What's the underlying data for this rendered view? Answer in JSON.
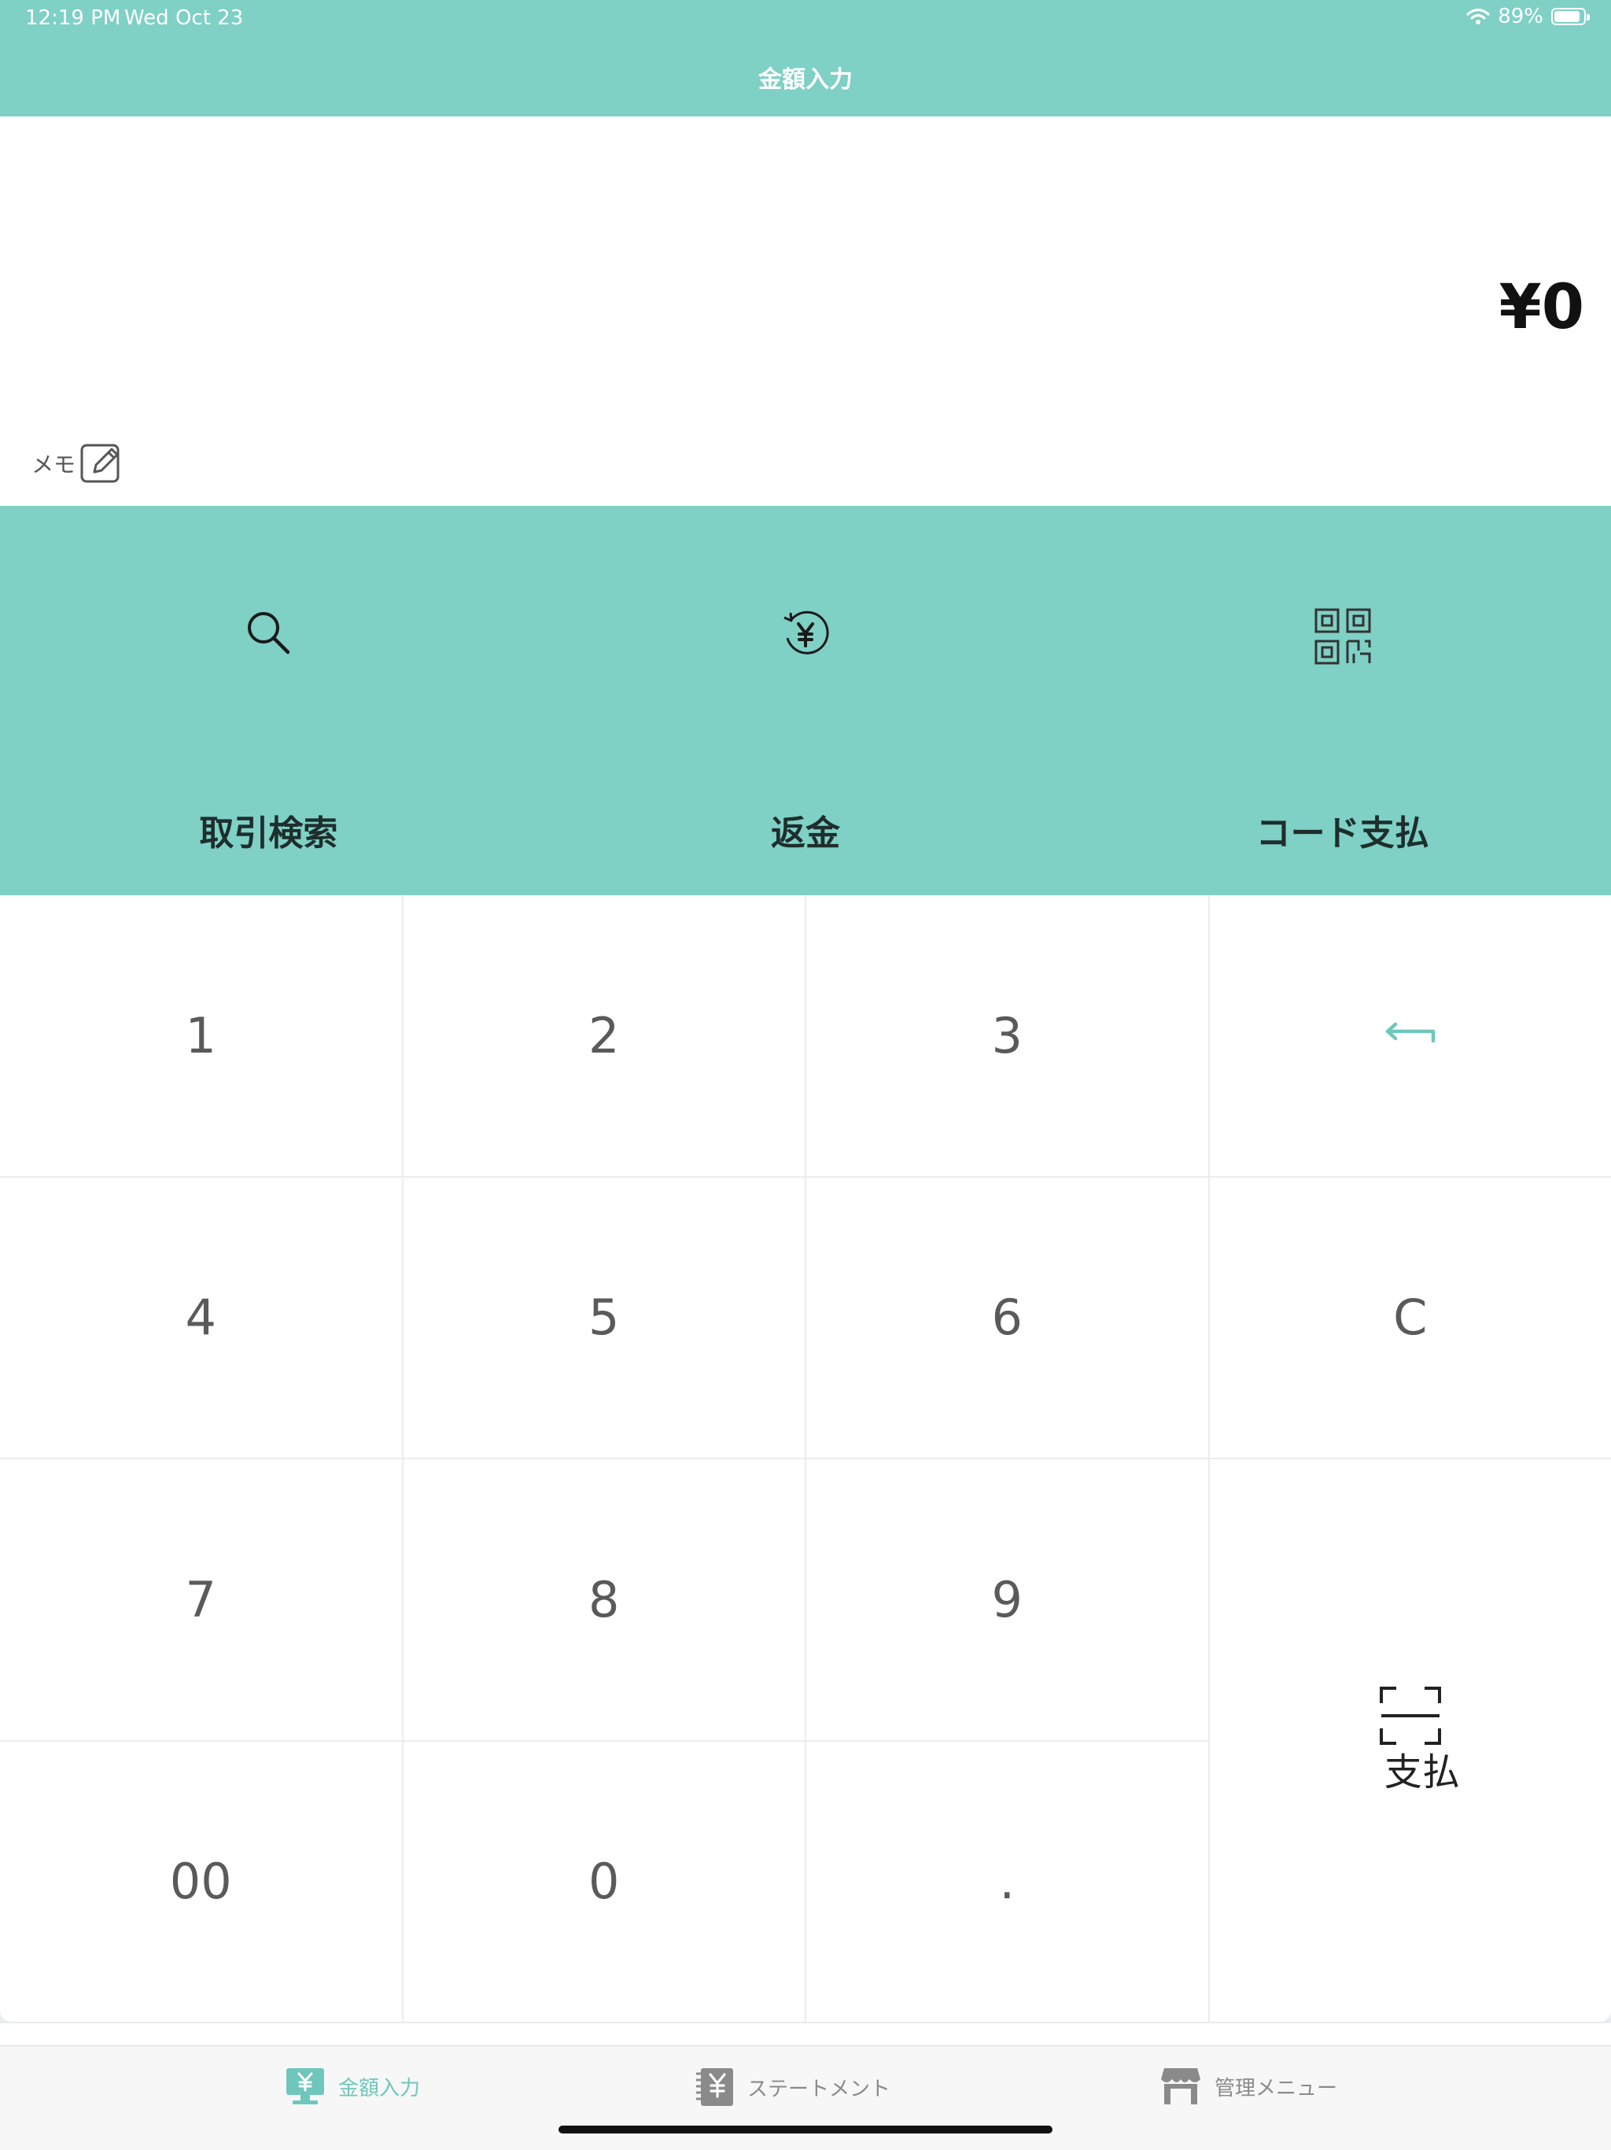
{
  "status": {
    "time": "12:19 PM",
    "date": "Wed Oct 23",
    "battery": "89%",
    "battery_level": 0.89
  },
  "nav": {
    "title": "金額入力"
  },
  "amount": {
    "display": "¥0"
  },
  "memo": {
    "label": "メモ",
    "icon": "edit-icon"
  },
  "actions": [
    {
      "label": "取引検索",
      "icon": "search-icon"
    },
    {
      "label": "返金",
      "icon": "refund-yen-icon"
    },
    {
      "label": "コード支払",
      "icon": "qr-code-icon"
    }
  ],
  "keypad": {
    "k1": "1",
    "k2": "2",
    "k3": "3",
    "backspace_icon": "backspace-arrow-icon",
    "k4": "4",
    "k5": "5",
    "k6": "6",
    "clear": "C",
    "k7": "7",
    "k8": "8",
    "k9": "9",
    "k00": "00",
    "k0": "0",
    "dot": ".",
    "pay_label": "支払",
    "pay_icon": "scan-frame-icon"
  },
  "colors": {
    "accent": "#7fd0c5",
    "tab_active": "#6fc7bb"
  },
  "tabs": [
    {
      "label": "金額入力",
      "icon": "yen-register-icon",
      "active": true
    },
    {
      "label": "ステートメント",
      "icon": "statement-notebook-icon",
      "active": false
    },
    {
      "label": "管理メニュー",
      "icon": "store-icon",
      "active": false
    }
  ]
}
